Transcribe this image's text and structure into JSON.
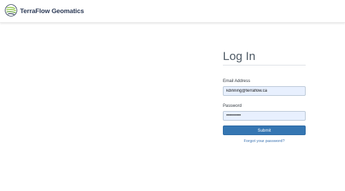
{
  "header": {
    "brand_name": "TerraFlow Geomatics",
    "logo_icon": "globe-leaf-icon",
    "colors": {
      "brand_text": "#2c3a56",
      "logo_green": "#8cc63f",
      "logo_dark": "#1f2f4a"
    }
  },
  "login": {
    "title": "Log In",
    "email_label": "Email Address",
    "email_value": "kdinning@terraflow.ca",
    "password_label": "Password",
    "password_value": "••••••••••",
    "submit_label": "Submit",
    "forgot_label": "Forgot your password?",
    "colors": {
      "button": "#3576b2",
      "link": "#3a72b0",
      "input_fill": "#e8f0fe"
    }
  }
}
